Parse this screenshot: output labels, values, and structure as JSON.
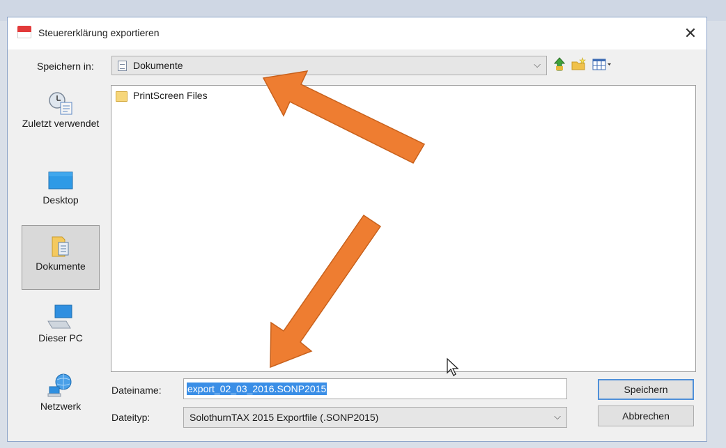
{
  "dialog": {
    "title": "Steuererklärung exportieren",
    "close_glyph": "✕"
  },
  "toolbar": {
    "save_in_label": "Speichern in:",
    "save_in_value": "Dokumente",
    "chevron_glyph": "⌵",
    "tools": [
      {
        "icon": "up-folder-icon"
      },
      {
        "icon": "new-folder-icon"
      },
      {
        "icon": "view-menu-icon"
      }
    ]
  },
  "places": [
    {
      "label": "Zuletzt verwendet",
      "icon": "recent-icon",
      "selected": false
    },
    {
      "label": "Desktop",
      "icon": "desktop-icon",
      "selected": false
    },
    {
      "label": "Dokumente",
      "icon": "documents-icon",
      "selected": true
    },
    {
      "label": "Dieser PC",
      "icon": "computer-icon",
      "selected": false
    },
    {
      "label": "Netzwerk",
      "icon": "network-icon",
      "selected": false
    }
  ],
  "files": [
    {
      "name": "PrintScreen Files",
      "icon": "folder-icon"
    }
  ],
  "form": {
    "filename_label": "Dateiname:",
    "filename_value": "export_02_03_2016.SONP2015",
    "filetype_label": "Dateityp:",
    "filetype_value": "SolothurnTAX 2015 Exportfile (.SONP2015)"
  },
  "buttons": {
    "save": "Speichern",
    "cancel": "Abbrechen"
  },
  "colors": {
    "annotation_arrow": "#ee7d31",
    "selection": "#3a8ee6",
    "default_button_border": "#4f90d9"
  }
}
